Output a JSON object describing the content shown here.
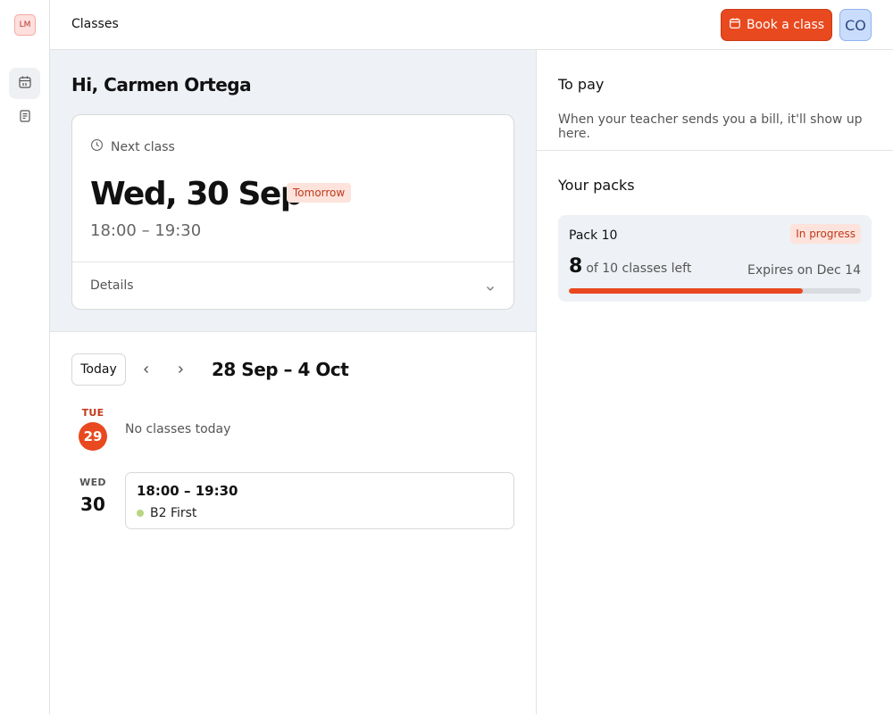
{
  "app": {
    "logo_text": "LM",
    "title": "Classes"
  },
  "header": {
    "book_label": "Book a class",
    "avatar_initials": "CO"
  },
  "sidebar": {
    "items": [
      {
        "icon": "calendar-icon",
        "active": true
      },
      {
        "icon": "receipt-icon",
        "active": false
      }
    ]
  },
  "greeting": "Hi, Carmen Ortega",
  "next_class": {
    "label": "Next class",
    "date": "Wed, 30 Sep",
    "badge": "Tomorrow",
    "time": "18:00 – 19:30",
    "details_label": "Details"
  },
  "week": {
    "today_label": "Today",
    "range": "28 Sep – 4 Oct",
    "days": [
      {
        "dow": "TUE",
        "num": "29",
        "today": true,
        "empty_text": "No classes today"
      },
      {
        "dow": "WED",
        "num": "30",
        "today": false,
        "class": {
          "time": "18:00 – 19:30",
          "name": "B2 First"
        }
      }
    ]
  },
  "to_pay": {
    "title": "To pay",
    "empty_text": "When your teacher sends you a bill, it'll show up here."
  },
  "packs": {
    "title": "Your packs",
    "items": [
      {
        "name": "Pack 10",
        "status": "In progress",
        "left": "8",
        "left_text": "of 10 classes left",
        "expires": "Expires on Dec 14",
        "progress": 0.8
      }
    ]
  },
  "colors": {
    "accent": "#e8491f",
    "class_dot": "#b9d57e"
  }
}
